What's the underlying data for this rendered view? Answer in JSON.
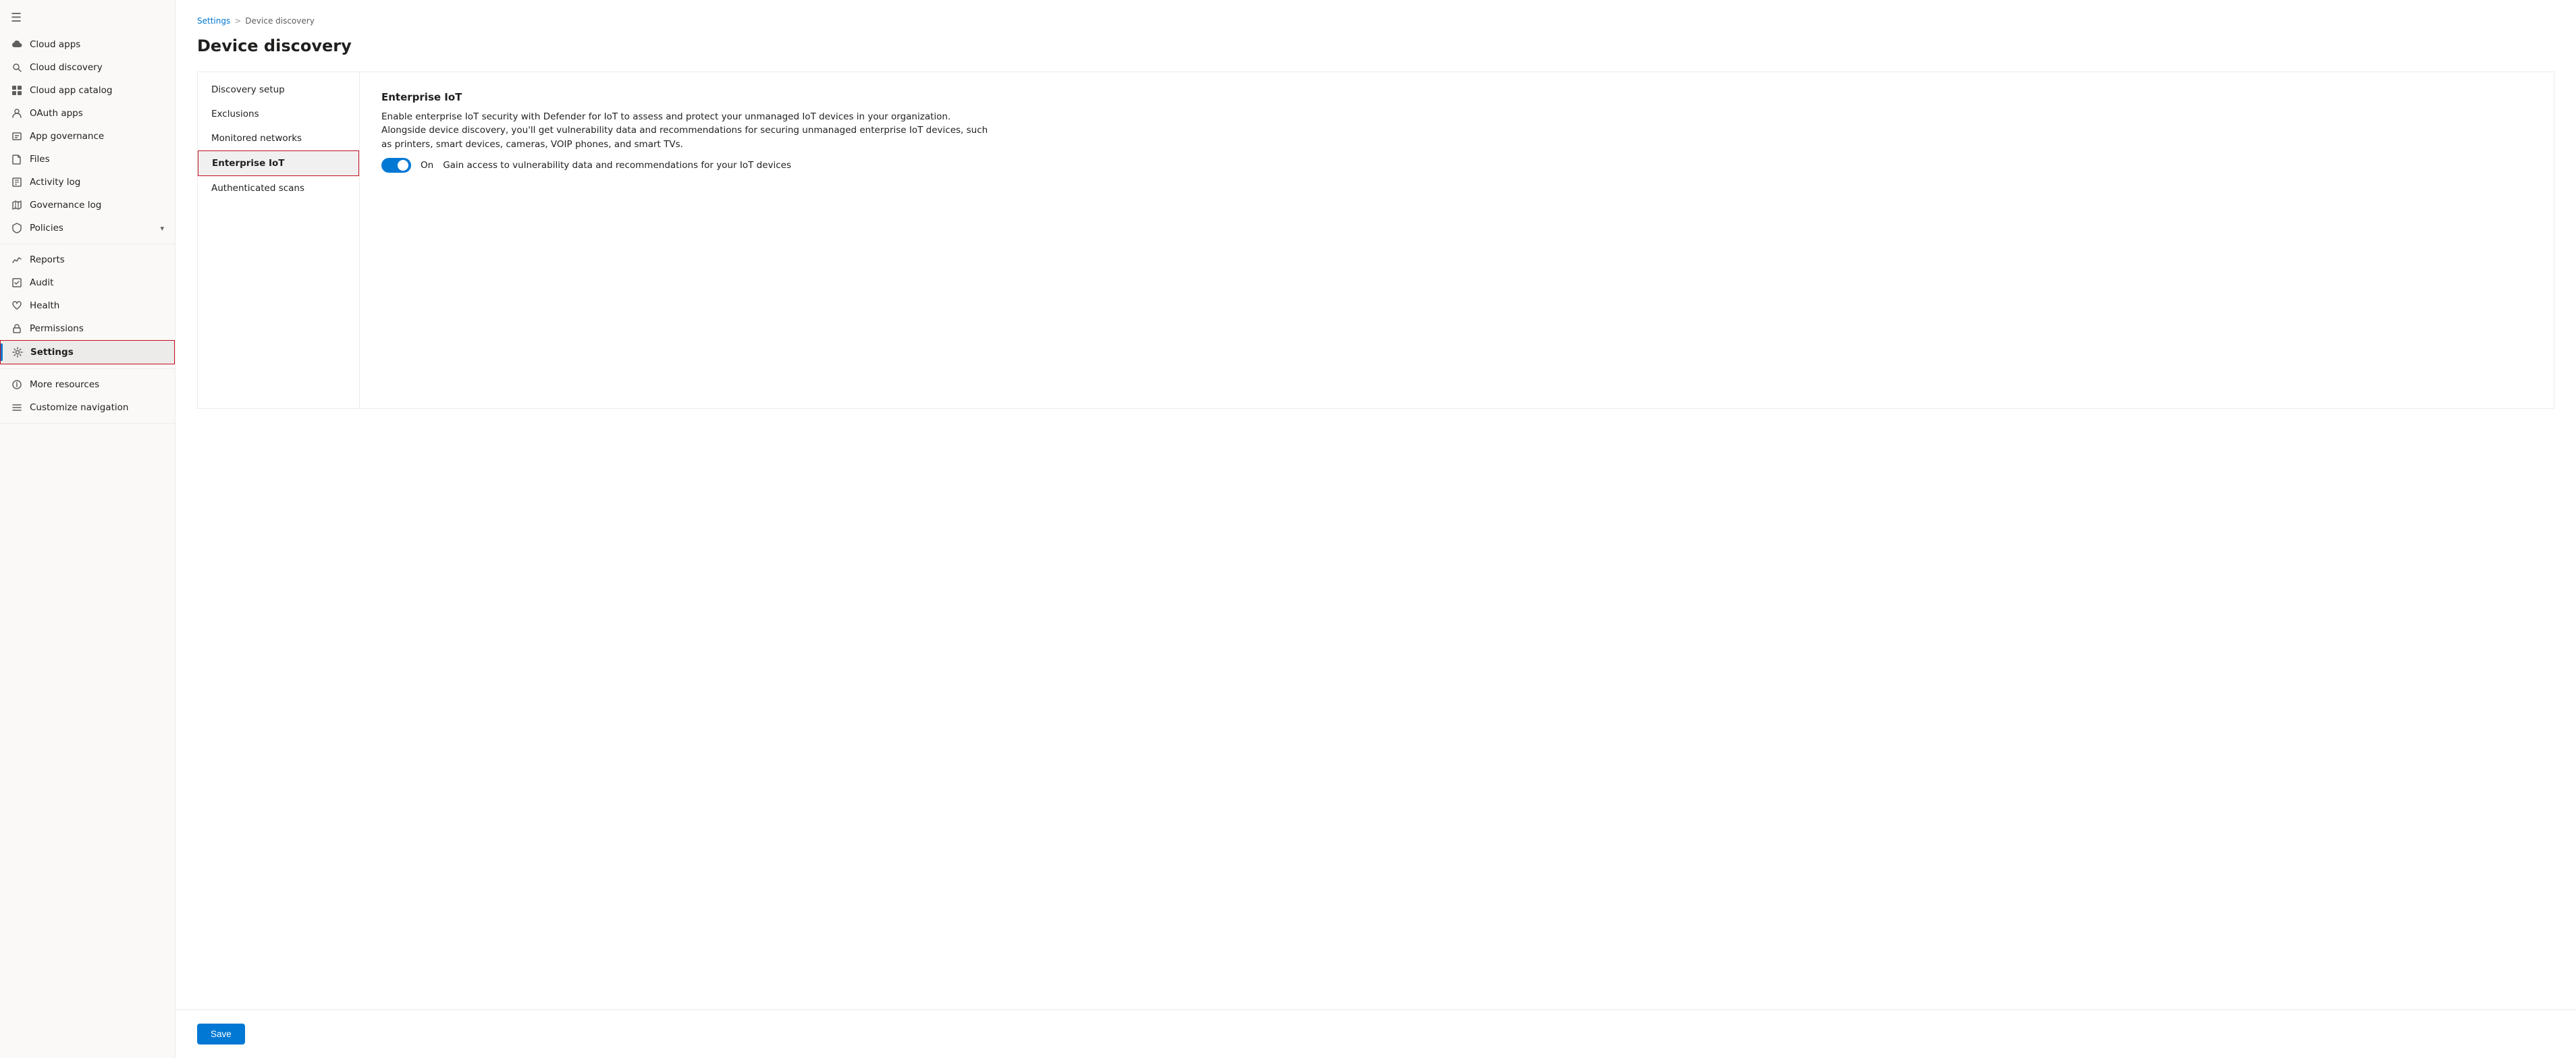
{
  "sidebar": {
    "hamburger": "≡",
    "items": [
      {
        "id": "cloud-apps",
        "label": "Cloud apps",
        "icon": "☁",
        "active": false
      },
      {
        "id": "cloud-discovery",
        "label": "Cloud discovery",
        "icon": "🔍",
        "active": false
      },
      {
        "id": "cloud-app-catalog",
        "label": "Cloud app catalog",
        "icon": "⊞",
        "active": false
      },
      {
        "id": "oauth-apps",
        "label": "OAuth apps",
        "icon": "⚙",
        "active": false
      },
      {
        "id": "app-governance",
        "label": "App governance",
        "icon": "📋",
        "active": false
      },
      {
        "id": "files",
        "label": "Files",
        "icon": "📄",
        "active": false
      },
      {
        "id": "activity-log",
        "label": "Activity log",
        "icon": "📊",
        "active": false
      },
      {
        "id": "governance-log",
        "label": "Governance log",
        "icon": "📓",
        "active": false
      },
      {
        "id": "policies",
        "label": "Policies",
        "icon": "🛡",
        "active": false,
        "hasChevron": true
      },
      {
        "id": "reports",
        "label": "Reports",
        "icon": "📈",
        "active": false
      },
      {
        "id": "audit",
        "label": "Audit",
        "icon": "📋",
        "active": false
      },
      {
        "id": "health",
        "label": "Health",
        "icon": "❤",
        "active": false
      },
      {
        "id": "permissions",
        "label": "Permissions",
        "icon": "🔑",
        "active": false
      },
      {
        "id": "settings",
        "label": "Settings",
        "icon": "⚙",
        "active": true,
        "highlighted": true
      },
      {
        "id": "more-resources",
        "label": "More resources",
        "icon": "ⓘ",
        "active": false
      },
      {
        "id": "customize-navigation",
        "label": "Customize navigation",
        "icon": "✏",
        "active": false
      }
    ]
  },
  "breadcrumb": {
    "items": [
      "Settings",
      "Device discovery"
    ],
    "separator": ">"
  },
  "page": {
    "title": "Device discovery"
  },
  "inner_nav": {
    "items": [
      {
        "id": "discovery-setup",
        "label": "Discovery setup",
        "active": false
      },
      {
        "id": "exclusions",
        "label": "Exclusions",
        "active": false
      },
      {
        "id": "monitored-networks",
        "label": "Monitored networks",
        "active": false
      },
      {
        "id": "enterprise-iot",
        "label": "Enterprise IoT",
        "active": true
      },
      {
        "id": "authenticated-scans",
        "label": "Authenticated scans",
        "active": false
      }
    ]
  },
  "enterprise_iot": {
    "title": "Enterprise IoT",
    "description": "Enable enterprise IoT security with Defender for IoT to assess and protect your unmanaged IoT devices in your organization. Alongside device discovery, you'll get vulnerability data and recommendations for securing unmanaged enterprise IoT devices, such as printers, smart devices, cameras, VOIP phones, and smart TVs.",
    "toggle": {
      "state": true,
      "label": "On",
      "hint": "Gain access to vulnerability data and recommendations for your IoT devices"
    }
  },
  "actions": {
    "save_label": "Save"
  }
}
